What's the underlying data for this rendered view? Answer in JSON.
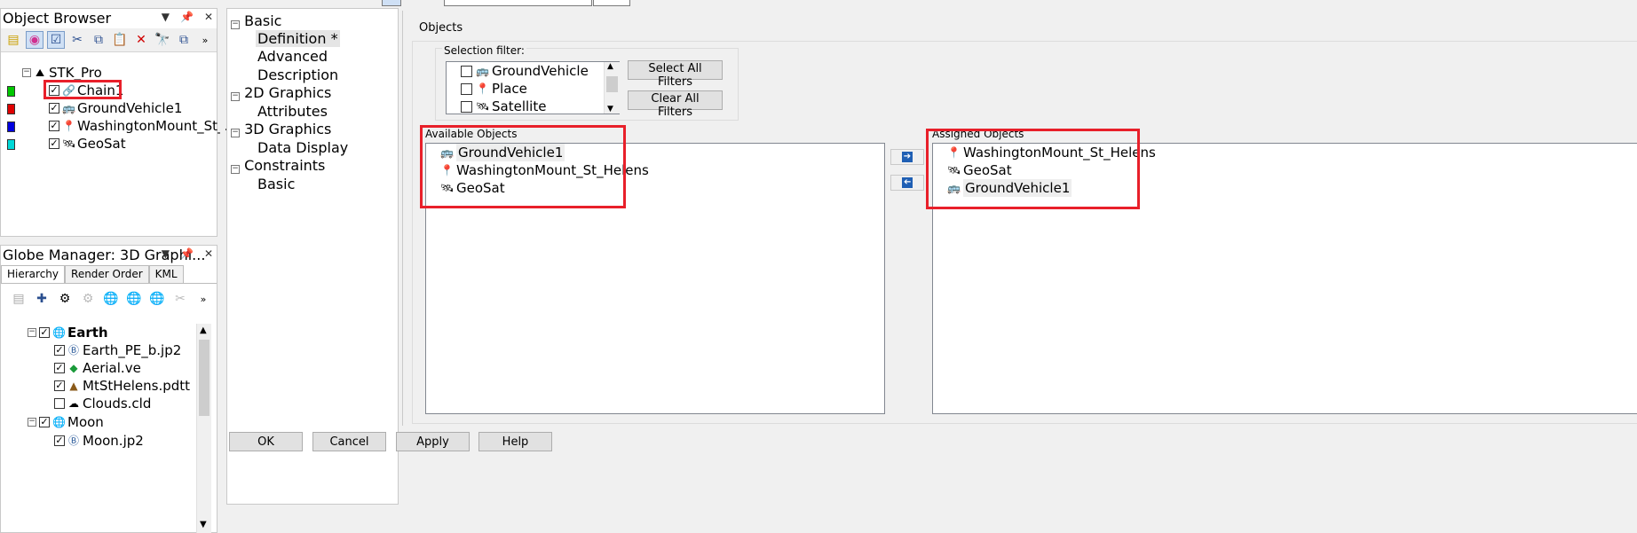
{
  "object_browser": {
    "title": "Object Browser",
    "tree": [
      {
        "label": "STK_Pro",
        "icon": "scenario-icon"
      },
      {
        "label": "Chain1",
        "icon": "chain-icon",
        "checked": true,
        "color": "#00c800"
      },
      {
        "label": "GroundVehicle1",
        "icon": "vehicle-icon",
        "checked": true,
        "color": "#e00000"
      },
      {
        "label": "WashingtonMount_St_...",
        "icon": "place-icon",
        "checked": true,
        "color": "#0000e0"
      },
      {
        "label": "GeoSat",
        "icon": "satellite-icon",
        "checked": true,
        "color": "#00d8d8"
      }
    ]
  },
  "globe_manager": {
    "title": "Globe Manager: 3D Graphi...",
    "tabs": [
      "Hierarchy",
      "Render Order",
      "KML"
    ],
    "tree": [
      {
        "label": "Earth",
        "checked": true,
        "bold": true,
        "expander": "⊟"
      },
      {
        "label": "Earth_PE_b.jp2",
        "checked": true
      },
      {
        "label": "Aerial.ve",
        "checked": true
      },
      {
        "label": "MtStHelens.pdtt",
        "checked": true
      },
      {
        "label": "Clouds.cld",
        "checked": false
      },
      {
        "label": "Moon",
        "checked": true,
        "bold": false,
        "expander": "⊟"
      },
      {
        "label": "Moon.jp2",
        "checked": true
      }
    ]
  },
  "property_tree": [
    {
      "label": "Basic",
      "expander": "⊟"
    },
    {
      "label": "Definition *",
      "selected": true
    },
    {
      "label": "Advanced"
    },
    {
      "label": "Description"
    },
    {
      "label": "2D Graphics",
      "expander": "⊟"
    },
    {
      "label": "Attributes"
    },
    {
      "label": "3D Graphics",
      "expander": "⊟"
    },
    {
      "label": "Data Display"
    },
    {
      "label": "Constraints",
      "expander": "⊟"
    },
    {
      "label": "Basic"
    }
  ],
  "objects": {
    "group_label": "Objects",
    "selection_filter_label": "Selection filter:",
    "filters": [
      {
        "label": "GroundVehicle",
        "checked": false
      },
      {
        "label": "Place",
        "checked": false
      },
      {
        "label": "Satellite",
        "checked": false
      }
    ],
    "select_all_label": "Select All Filters",
    "clear_all_label": "Clear All Filters",
    "available_label": "Available Objects",
    "available": [
      "GroundVehicle1",
      "WashingtonMount_St_Helens",
      "GeoSat"
    ],
    "assigned_label": "Assigned Objects",
    "assigned": [
      "WashingtonMount_St_Helens",
      "GeoSat",
      "GroundVehicle1"
    ]
  },
  "buttons": {
    "ok": "OK",
    "cancel": "Cancel",
    "apply": "Apply",
    "help": "Help"
  }
}
